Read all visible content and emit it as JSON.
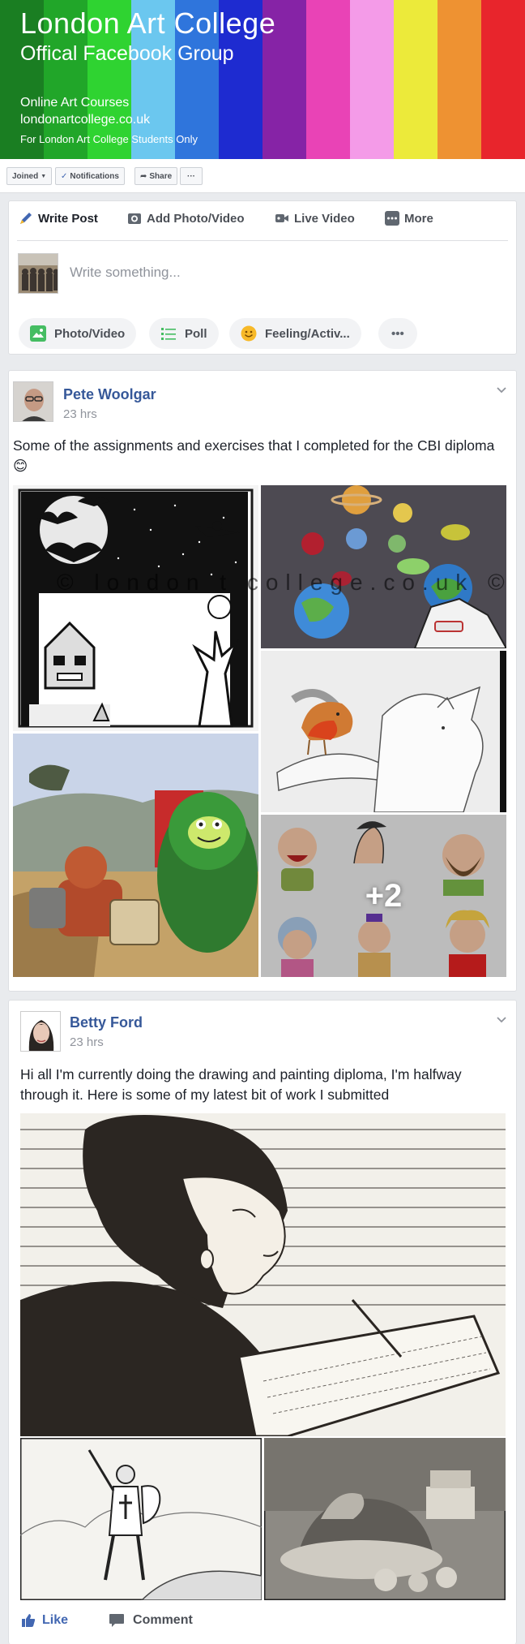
{
  "cover": {
    "title": "London Art College",
    "subtitle": "Offical Facebook Group",
    "line1": "Online Art Courses",
    "line2": "londonartcollege.co.uk",
    "line3": "For London Art College Students Only",
    "stripe_colors": [
      "#1a7e22",
      "#21a629",
      "#2fd331",
      "#6bc7ef",
      "#2f75dc",
      "#1e2bd0",
      "#8623a6",
      "#e943b6",
      "#f49be8",
      "#ecea3a",
      "#ee9232",
      "#e8252c"
    ]
  },
  "group_actions": {
    "joined": "Joined",
    "notifications": "Notifications",
    "share": "Share",
    "more": "···"
  },
  "composer": {
    "tabs": {
      "write_post": "Write Post",
      "add_photo": "Add Photo/Video",
      "live_video": "Live Video",
      "more": "More"
    },
    "placeholder": "Write something...",
    "options": {
      "photo_video": "Photo/Video",
      "poll": "Poll",
      "feeling": "Feeling/Activ...",
      "more": "•••"
    }
  },
  "posts": [
    {
      "author": "Pete Woolgar",
      "time": "23 hrs",
      "text": "Some of the assignments and exercises that I completed for the CBI diploma 😊",
      "watermark": "© london   t college.co.uk ©",
      "more_photos": "+2"
    },
    {
      "author": "Betty Ford",
      "time": "23 hrs",
      "text": "Hi all I'm currently doing the drawing and painting diploma, I'm halfway through it. Here is some of my latest bit of work I submitted",
      "actions": {
        "like": "Like",
        "comment": "Comment"
      }
    }
  ],
  "colors": {
    "link_blue": "#365899",
    "like_blue": "#4267b2",
    "page_bg": "#e9ebee"
  }
}
